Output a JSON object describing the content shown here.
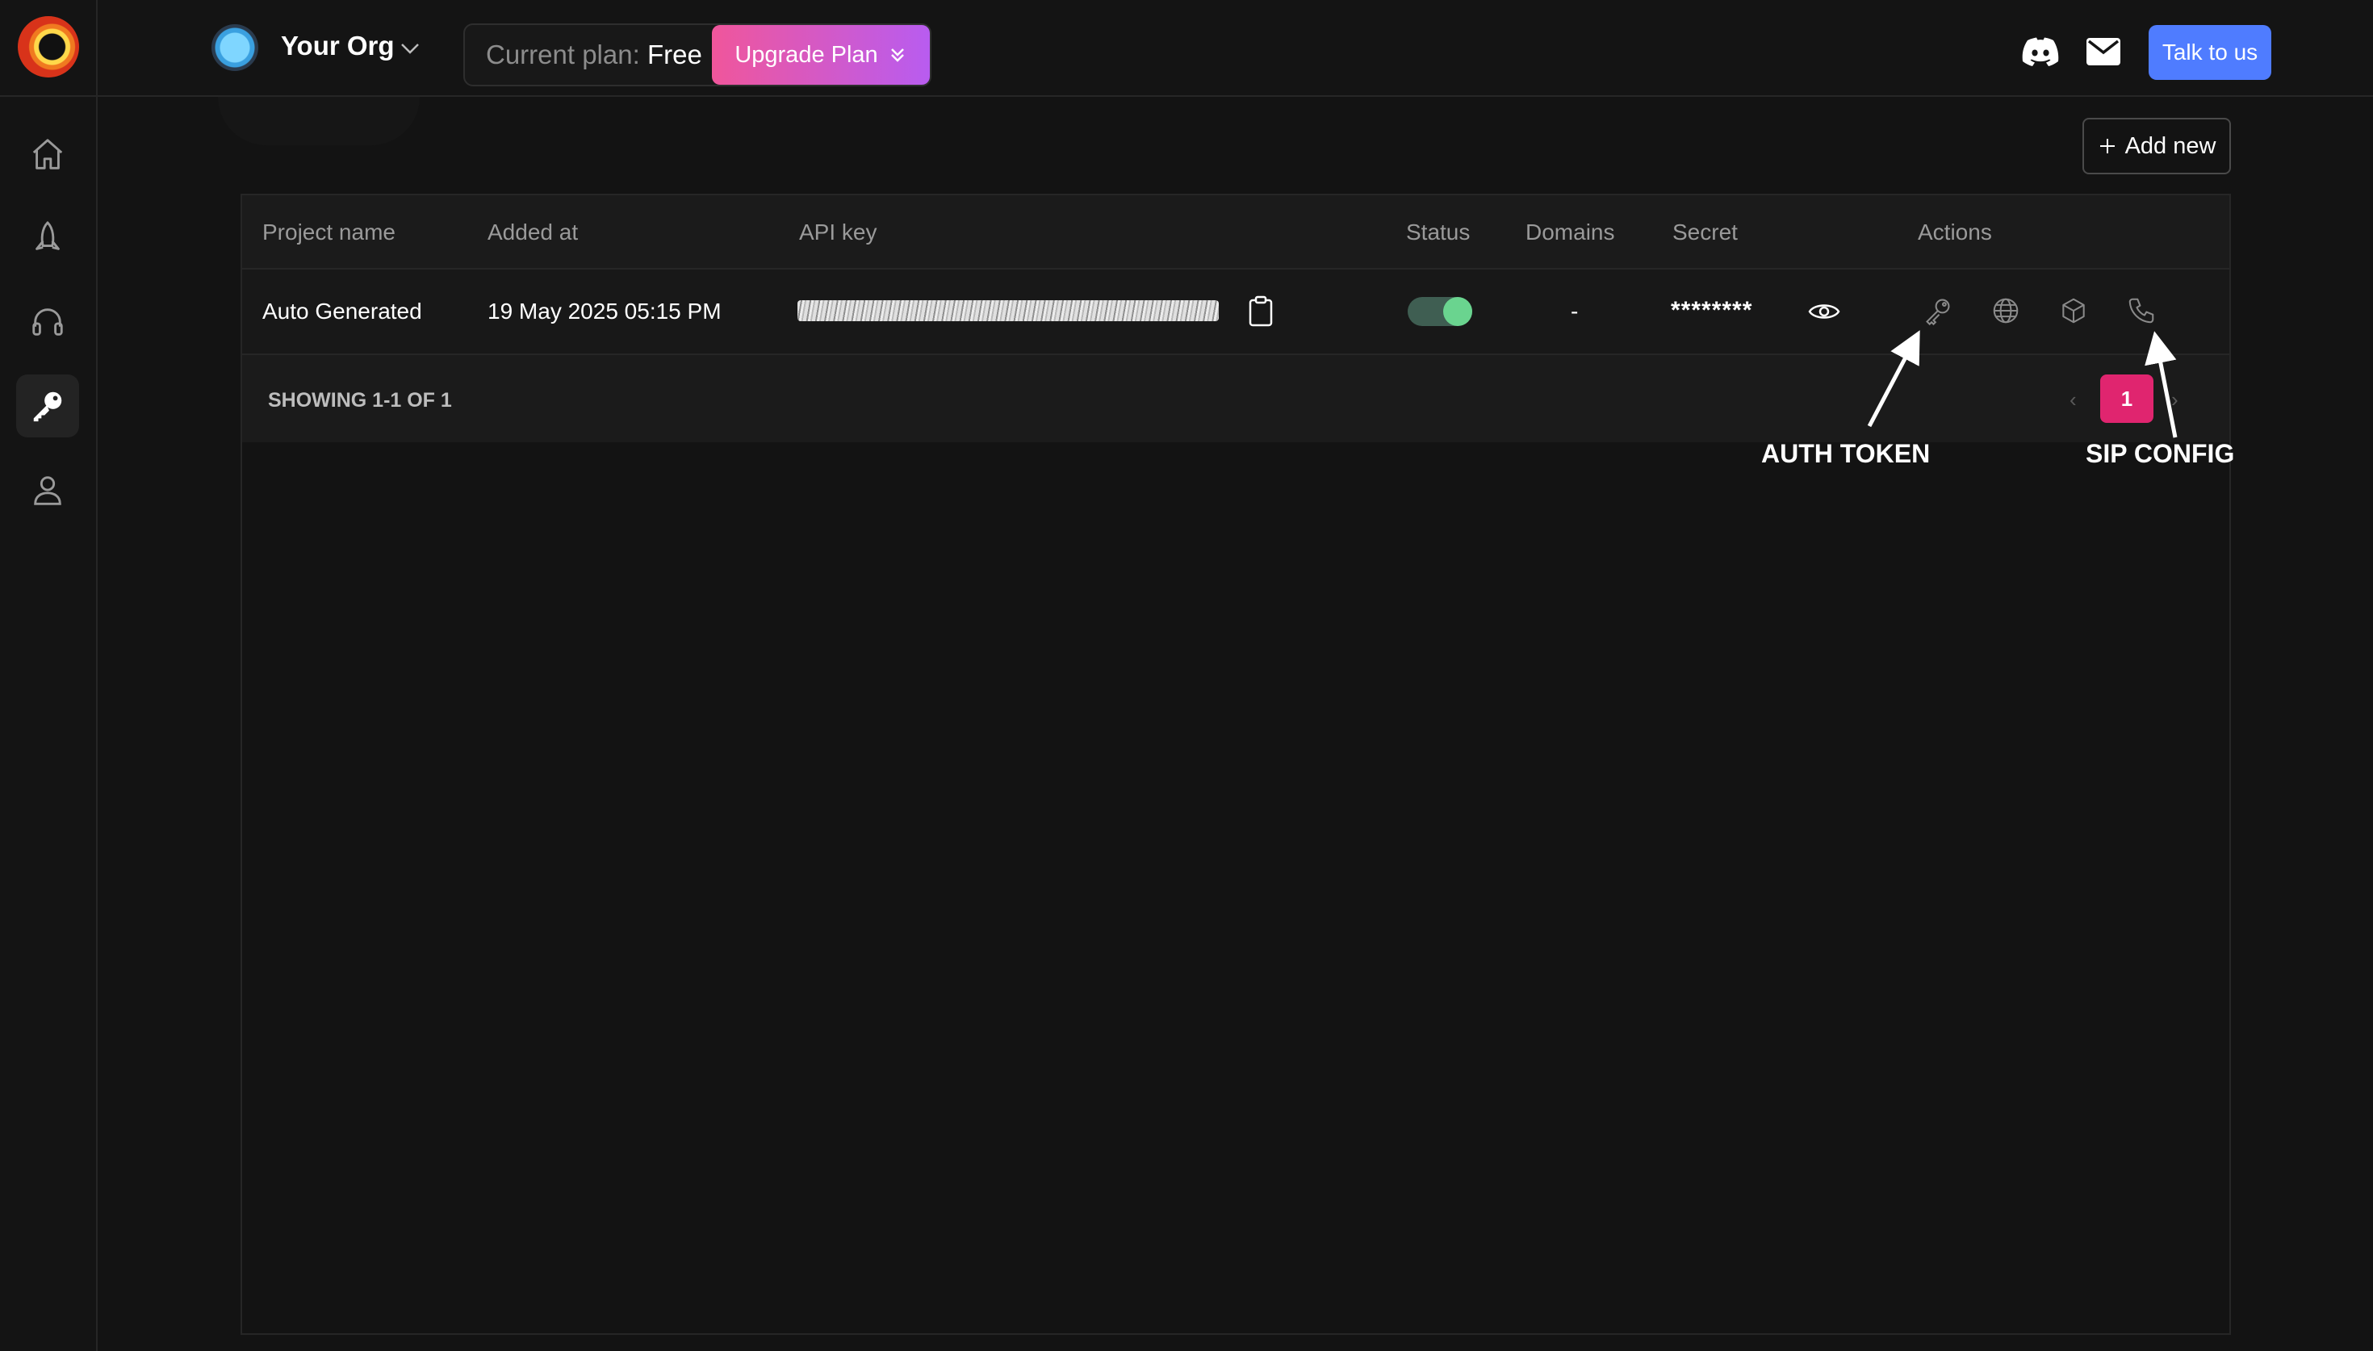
{
  "org": {
    "name": "Your Org"
  },
  "plan": {
    "label": "Current plan:",
    "value": "Free",
    "upgrade_label": "Upgrade Plan"
  },
  "header": {
    "talk_label": "Talk to us"
  },
  "sidebar": {
    "items": [
      {
        "icon": "home-icon",
        "active": false
      },
      {
        "icon": "rocket-icon",
        "active": false
      },
      {
        "icon": "headphones-icon",
        "active": false
      },
      {
        "icon": "key-icon",
        "active": true
      },
      {
        "icon": "user-icon",
        "active": false
      }
    ]
  },
  "main": {
    "add_new_label": "Add new"
  },
  "table": {
    "columns": [
      "Project name",
      "Added at",
      "API key",
      "Status",
      "Domains",
      "Secret",
      "Actions"
    ],
    "rows": [
      {
        "project_name": "Auto Generated",
        "added_at": "19 May 2025 05:15 PM",
        "status": "on",
        "domains": "-",
        "secret": "********"
      }
    ],
    "footer": {
      "showing": "SHOWING 1-1 OF 1",
      "current_page": "1"
    }
  },
  "annotations": {
    "auth_token": "AUTH TOKEN",
    "sip_config": "SIP CONFIG"
  },
  "colors": {
    "accent": "#e0256f",
    "talk": "#4f7cff",
    "toggle_on": "#6ad48f"
  }
}
